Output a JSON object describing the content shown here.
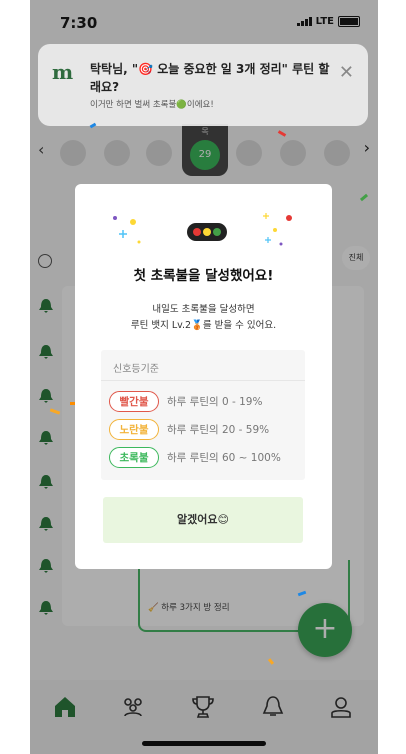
{
  "status_bar": {
    "time": "7:30",
    "network": "LTE"
  },
  "notification": {
    "logo": "m",
    "title": "탁탁님, \"🎯 오늘 중요한 일 3개 정리\" 루틴 할래요?",
    "subtitle": "이거만 하면 벌써 초록불🟢이에요!"
  },
  "calendar": {
    "today": "29",
    "today_label": "목"
  },
  "background": {
    "chip_label": "진체",
    "routine_bottom": "🧹 하루 3가지 방 정리"
  },
  "modal": {
    "title": "첫 초록불을 달성했어요!",
    "body_line1": "내일도 초록불을 달성하면",
    "body_line2": "루틴 뱃지 Lv.2🥉를 받을 수 있어요.",
    "criteria_title": "신호등기준",
    "criteria": [
      {
        "badge": "빨간불",
        "text": "하루 루틴의 0 - 19%",
        "color": "#e0574a"
      },
      {
        "badge": "노란불",
        "text": "하루 루틴의 20 - 59%",
        "color": "#f2b33a"
      },
      {
        "badge": "초록불",
        "text": "하루 루틴의 60 ~ 100%",
        "color": "#3cb85c"
      }
    ],
    "confirm": "알겠어요😊"
  },
  "colors": {
    "accent": "#3cb85c",
    "dim_overlay": "rgba(0,0,0,0.32)"
  }
}
